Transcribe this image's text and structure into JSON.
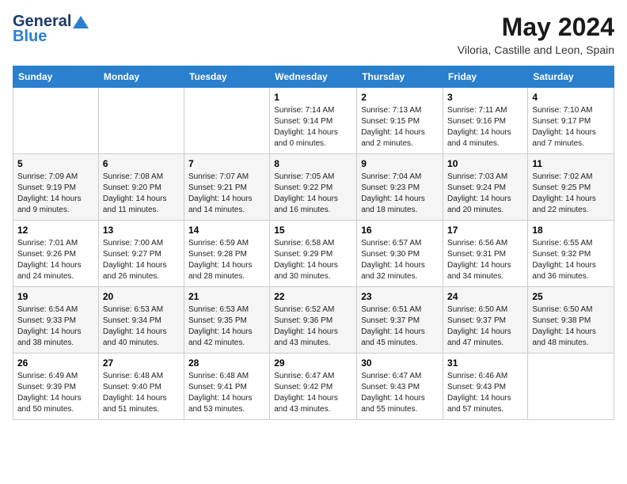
{
  "header": {
    "logo_general": "General",
    "logo_blue": "Blue",
    "month_year": "May 2024",
    "location": "Viloria, Castille and Leon, Spain"
  },
  "weekdays": [
    "Sunday",
    "Monday",
    "Tuesday",
    "Wednesday",
    "Thursday",
    "Friday",
    "Saturday"
  ],
  "weeks": [
    [
      {
        "day": "",
        "content": ""
      },
      {
        "day": "",
        "content": ""
      },
      {
        "day": "",
        "content": ""
      },
      {
        "day": "1",
        "content": "Sunrise: 7:14 AM\nSunset: 9:14 PM\nDaylight: 14 hours and 0 minutes."
      },
      {
        "day": "2",
        "content": "Sunrise: 7:13 AM\nSunset: 9:15 PM\nDaylight: 14 hours and 2 minutes."
      },
      {
        "day": "3",
        "content": "Sunrise: 7:11 AM\nSunset: 9:16 PM\nDaylight: 14 hours and 4 minutes."
      },
      {
        "day": "4",
        "content": "Sunrise: 7:10 AM\nSunset: 9:17 PM\nDaylight: 14 hours and 7 minutes."
      }
    ],
    [
      {
        "day": "5",
        "content": "Sunrise: 7:09 AM\nSunset: 9:19 PM\nDaylight: 14 hours and 9 minutes."
      },
      {
        "day": "6",
        "content": "Sunrise: 7:08 AM\nSunset: 9:20 PM\nDaylight: 14 hours and 11 minutes."
      },
      {
        "day": "7",
        "content": "Sunrise: 7:07 AM\nSunset: 9:21 PM\nDaylight: 14 hours and 14 minutes."
      },
      {
        "day": "8",
        "content": "Sunrise: 7:05 AM\nSunset: 9:22 PM\nDaylight: 14 hours and 16 minutes."
      },
      {
        "day": "9",
        "content": "Sunrise: 7:04 AM\nSunset: 9:23 PM\nDaylight: 14 hours and 18 minutes."
      },
      {
        "day": "10",
        "content": "Sunrise: 7:03 AM\nSunset: 9:24 PM\nDaylight: 14 hours and 20 minutes."
      },
      {
        "day": "11",
        "content": "Sunrise: 7:02 AM\nSunset: 9:25 PM\nDaylight: 14 hours and 22 minutes."
      }
    ],
    [
      {
        "day": "12",
        "content": "Sunrise: 7:01 AM\nSunset: 9:26 PM\nDaylight: 14 hours and 24 minutes."
      },
      {
        "day": "13",
        "content": "Sunrise: 7:00 AM\nSunset: 9:27 PM\nDaylight: 14 hours and 26 minutes."
      },
      {
        "day": "14",
        "content": "Sunrise: 6:59 AM\nSunset: 9:28 PM\nDaylight: 14 hours and 28 minutes."
      },
      {
        "day": "15",
        "content": "Sunrise: 6:58 AM\nSunset: 9:29 PM\nDaylight: 14 hours and 30 minutes."
      },
      {
        "day": "16",
        "content": "Sunrise: 6:57 AM\nSunset: 9:30 PM\nDaylight: 14 hours and 32 minutes."
      },
      {
        "day": "17",
        "content": "Sunrise: 6:56 AM\nSunset: 9:31 PM\nDaylight: 14 hours and 34 minutes."
      },
      {
        "day": "18",
        "content": "Sunrise: 6:55 AM\nSunset: 9:32 PM\nDaylight: 14 hours and 36 minutes."
      }
    ],
    [
      {
        "day": "19",
        "content": "Sunrise: 6:54 AM\nSunset: 9:33 PM\nDaylight: 14 hours and 38 minutes."
      },
      {
        "day": "20",
        "content": "Sunrise: 6:53 AM\nSunset: 9:34 PM\nDaylight: 14 hours and 40 minutes."
      },
      {
        "day": "21",
        "content": "Sunrise: 6:53 AM\nSunset: 9:35 PM\nDaylight: 14 hours and 42 minutes."
      },
      {
        "day": "22",
        "content": "Sunrise: 6:52 AM\nSunset: 9:36 PM\nDaylight: 14 hours and 43 minutes."
      },
      {
        "day": "23",
        "content": "Sunrise: 6:51 AM\nSunset: 9:37 PM\nDaylight: 14 hours and 45 minutes."
      },
      {
        "day": "24",
        "content": "Sunrise: 6:50 AM\nSunset: 9:37 PM\nDaylight: 14 hours and 47 minutes."
      },
      {
        "day": "25",
        "content": "Sunrise: 6:50 AM\nSunset: 9:38 PM\nDaylight: 14 hours and 48 minutes."
      }
    ],
    [
      {
        "day": "26",
        "content": "Sunrise: 6:49 AM\nSunset: 9:39 PM\nDaylight: 14 hours and 50 minutes."
      },
      {
        "day": "27",
        "content": "Sunrise: 6:48 AM\nSunset: 9:40 PM\nDaylight: 14 hours and 51 minutes."
      },
      {
        "day": "28",
        "content": "Sunrise: 6:48 AM\nSunset: 9:41 PM\nDaylight: 14 hours and 53 minutes."
      },
      {
        "day": "29",
        "content": "Sunrise: 6:47 AM\nSunset: 9:42 PM\nDaylight: 14 hours and 43 minutes."
      },
      {
        "day": "30",
        "content": "Sunrise: 6:47 AM\nSunset: 9:43 PM\nDaylight: 14 hours and 55 minutes."
      },
      {
        "day": "31",
        "content": "Sunrise: 6:46 AM\nSunset: 9:43 PM\nDaylight: 14 hours and 57 minutes."
      },
      {
        "day": "",
        "content": ""
      }
    ]
  ]
}
